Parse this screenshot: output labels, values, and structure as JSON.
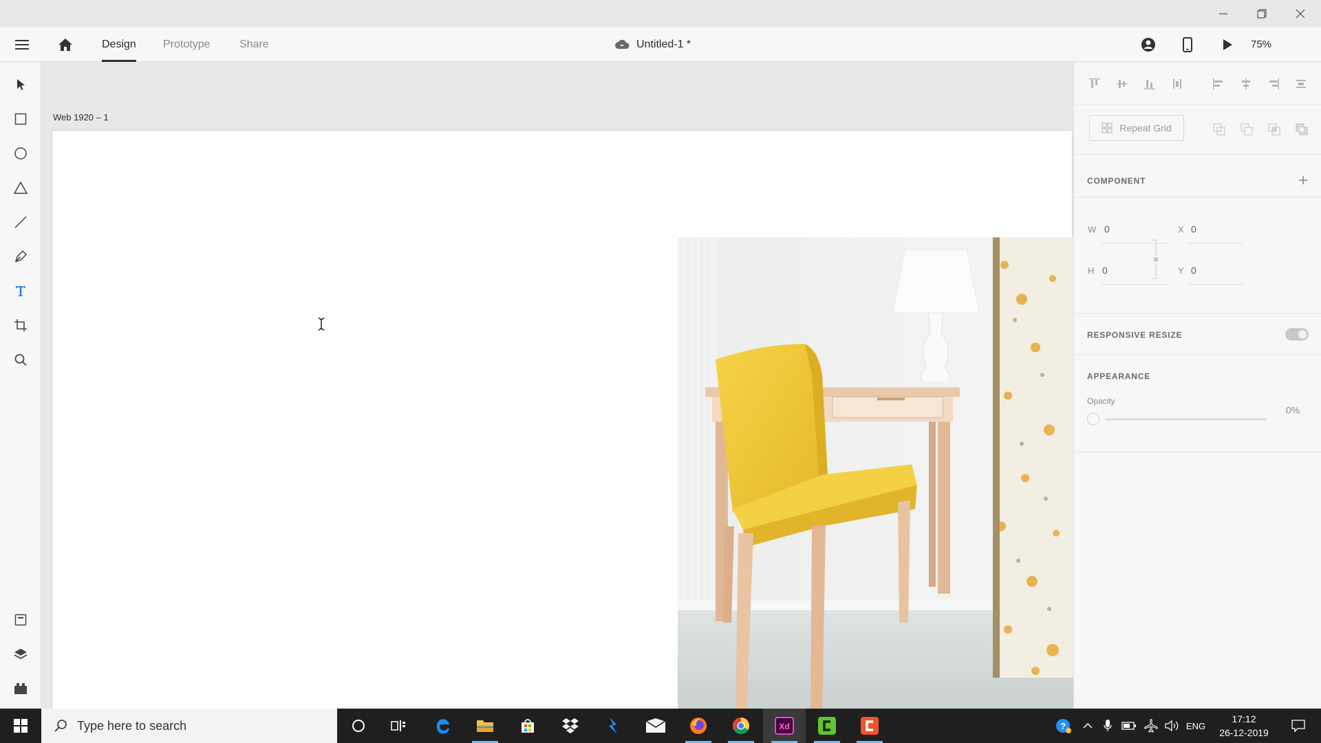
{
  "titlebar": {
    "minimize_icon": "minimize-icon",
    "restore_icon": "restore-icon",
    "close_icon": "close-icon"
  },
  "appbar": {
    "tabs": [
      {
        "label": "Design",
        "active": true
      },
      {
        "label": "Prototype",
        "active": false
      },
      {
        "label": "Share",
        "active": false
      }
    ],
    "document_title": "Untitled-1 *",
    "zoom": "75%"
  },
  "canvas": {
    "artboard_label": "Web 1920 – 1"
  },
  "panel": {
    "repeat_grid_label": "Repeat Grid",
    "component_title": "COMPONENT",
    "fields": {
      "w_label": "W",
      "w_value": "0",
      "h_label": "H",
      "h_value": "0",
      "x_label": "X",
      "x_value": "0",
      "y_label": "Y",
      "y_value": "0"
    },
    "responsive_resize_title": "RESPONSIVE RESIZE",
    "responsive_resize_on": true,
    "appearance_title": "APPEARANCE",
    "opacity_label": "Opacity",
    "opacity_value": "0%"
  },
  "taskbar": {
    "search_placeholder": "Type here to search",
    "language": "ENG",
    "time": "17:12",
    "date": "26-12-2019"
  },
  "colors": {
    "accent": "#2680eb",
    "xd_brand": "#ff61f6",
    "chair_yellow": "#f2c832"
  }
}
